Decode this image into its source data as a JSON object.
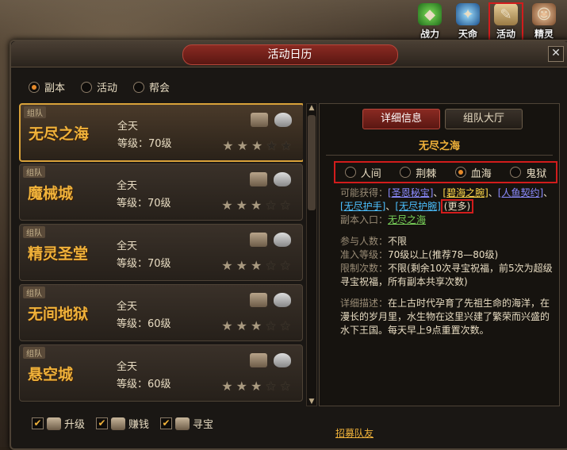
{
  "top_icons": [
    {
      "label": "战力",
      "icon": "green-gem-icon"
    },
    {
      "label": "天命",
      "icon": "blue-orb-icon"
    },
    {
      "label": "活动",
      "icon": "scroll-quill-icon",
      "selected": true
    },
    {
      "label": "精灵",
      "icon": "spirit-portrait-icon"
    }
  ],
  "window": {
    "title": "活动日历",
    "close": "✕"
  },
  "filters": [
    {
      "label": "副本",
      "checked": true
    },
    {
      "label": "活动",
      "checked": false
    },
    {
      "label": "帮会",
      "checked": false
    }
  ],
  "dungeons": [
    {
      "tag": "组队",
      "name": "无尽之海",
      "time": "全天",
      "level": "等级：70级",
      "stars": 3,
      "selected": true
    },
    {
      "tag": "组队",
      "name": "魔械城",
      "time": "全天",
      "level": "等级：70级",
      "stars": 3
    },
    {
      "tag": "组队",
      "name": "精灵圣堂",
      "time": "全天",
      "level": "等级：70级",
      "stars": 3
    },
    {
      "tag": "组队",
      "name": "无间地狱",
      "time": "全天",
      "level": "等级：60级",
      "stars": 3
    },
    {
      "tag": "组队",
      "name": "悬空城",
      "time": "全天",
      "level": "等级：60级",
      "stars": 3
    }
  ],
  "tabs": [
    {
      "label": "详细信息",
      "active": true
    },
    {
      "label": "组队大厅",
      "active": false
    }
  ],
  "detail": {
    "title": "无尽之海",
    "modes": [
      {
        "label": "人间",
        "checked": false
      },
      {
        "label": "荆棘",
        "checked": false
      },
      {
        "label": "血海",
        "checked": true
      },
      {
        "label": "鬼狱",
        "checked": false
      }
    ],
    "rewards_label": "可能获得：",
    "rewards": [
      "[圣恩秘宝]",
      "[碧海之腕]",
      "[人鱼契约]",
      "[无尽护手]",
      "[无尽护腕]"
    ],
    "sep": "、",
    "more": "(更多)",
    "entrance_label": "副本入口：",
    "entrance": "无尽之海",
    "players_label": "参与人数：",
    "players": "不限",
    "level_label": "准入等级：",
    "level": "70级以上(推荐78—80级)",
    "limit_label": "限制次数：",
    "limit": "不限(剩余10次寻宝祝福，前5次为超级寻宝祝福，所有副本共享次数)",
    "desc_label": "详细描述：",
    "desc": "在上古时代孕育了先祖生命的海洋，在漫长的岁月里，水生物在这里兴建了繁荣而兴盛的水下王国。每天早上9点重置次数。",
    "recruit": "招募队友"
  },
  "bottom_filters": [
    {
      "label": "升级",
      "checked": true,
      "icon": "sword-icon"
    },
    {
      "label": "赚钱",
      "checked": true,
      "icon": "money-bag-icon"
    },
    {
      "label": "寻宝",
      "checked": true,
      "icon": "treasure-chest-icon"
    }
  ],
  "colors": {
    "accent": "#f0b23a",
    "highlight_red": "#d21c1c",
    "selected_border": "#d9a23a"
  }
}
